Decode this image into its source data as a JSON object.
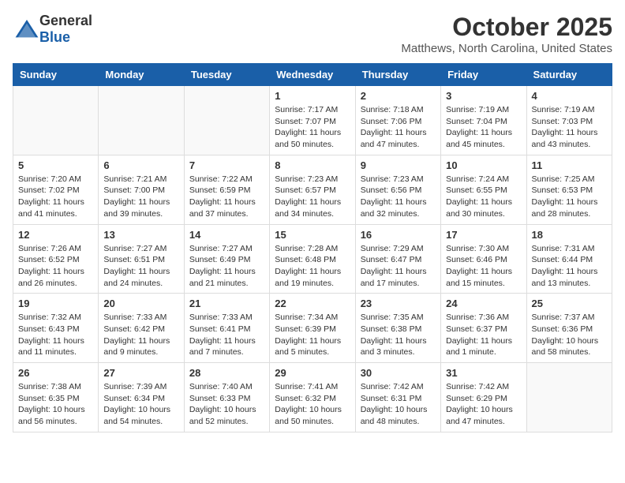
{
  "logo": {
    "general": "General",
    "blue": "Blue"
  },
  "title": "October 2025",
  "location": "Matthews, North Carolina, United States",
  "days_of_week": [
    "Sunday",
    "Monday",
    "Tuesday",
    "Wednesday",
    "Thursday",
    "Friday",
    "Saturday"
  ],
  "weeks": [
    [
      {
        "day": "",
        "info": ""
      },
      {
        "day": "",
        "info": ""
      },
      {
        "day": "",
        "info": ""
      },
      {
        "day": "1",
        "info": "Sunrise: 7:17 AM\nSunset: 7:07 PM\nDaylight: 11 hours\nand 50 minutes."
      },
      {
        "day": "2",
        "info": "Sunrise: 7:18 AM\nSunset: 7:06 PM\nDaylight: 11 hours\nand 47 minutes."
      },
      {
        "day": "3",
        "info": "Sunrise: 7:19 AM\nSunset: 7:04 PM\nDaylight: 11 hours\nand 45 minutes."
      },
      {
        "day": "4",
        "info": "Sunrise: 7:19 AM\nSunset: 7:03 PM\nDaylight: 11 hours\nand 43 minutes."
      }
    ],
    [
      {
        "day": "5",
        "info": "Sunrise: 7:20 AM\nSunset: 7:02 PM\nDaylight: 11 hours\nand 41 minutes."
      },
      {
        "day": "6",
        "info": "Sunrise: 7:21 AM\nSunset: 7:00 PM\nDaylight: 11 hours\nand 39 minutes."
      },
      {
        "day": "7",
        "info": "Sunrise: 7:22 AM\nSunset: 6:59 PM\nDaylight: 11 hours\nand 37 minutes."
      },
      {
        "day": "8",
        "info": "Sunrise: 7:23 AM\nSunset: 6:57 PM\nDaylight: 11 hours\nand 34 minutes."
      },
      {
        "day": "9",
        "info": "Sunrise: 7:23 AM\nSunset: 6:56 PM\nDaylight: 11 hours\nand 32 minutes."
      },
      {
        "day": "10",
        "info": "Sunrise: 7:24 AM\nSunset: 6:55 PM\nDaylight: 11 hours\nand 30 minutes."
      },
      {
        "day": "11",
        "info": "Sunrise: 7:25 AM\nSunset: 6:53 PM\nDaylight: 11 hours\nand 28 minutes."
      }
    ],
    [
      {
        "day": "12",
        "info": "Sunrise: 7:26 AM\nSunset: 6:52 PM\nDaylight: 11 hours\nand 26 minutes."
      },
      {
        "day": "13",
        "info": "Sunrise: 7:27 AM\nSunset: 6:51 PM\nDaylight: 11 hours\nand 24 minutes."
      },
      {
        "day": "14",
        "info": "Sunrise: 7:27 AM\nSunset: 6:49 PM\nDaylight: 11 hours\nand 21 minutes."
      },
      {
        "day": "15",
        "info": "Sunrise: 7:28 AM\nSunset: 6:48 PM\nDaylight: 11 hours\nand 19 minutes."
      },
      {
        "day": "16",
        "info": "Sunrise: 7:29 AM\nSunset: 6:47 PM\nDaylight: 11 hours\nand 17 minutes."
      },
      {
        "day": "17",
        "info": "Sunrise: 7:30 AM\nSunset: 6:46 PM\nDaylight: 11 hours\nand 15 minutes."
      },
      {
        "day": "18",
        "info": "Sunrise: 7:31 AM\nSunset: 6:44 PM\nDaylight: 11 hours\nand 13 minutes."
      }
    ],
    [
      {
        "day": "19",
        "info": "Sunrise: 7:32 AM\nSunset: 6:43 PM\nDaylight: 11 hours\nand 11 minutes."
      },
      {
        "day": "20",
        "info": "Sunrise: 7:33 AM\nSunset: 6:42 PM\nDaylight: 11 hours\nand 9 minutes."
      },
      {
        "day": "21",
        "info": "Sunrise: 7:33 AM\nSunset: 6:41 PM\nDaylight: 11 hours\nand 7 minutes."
      },
      {
        "day": "22",
        "info": "Sunrise: 7:34 AM\nSunset: 6:39 PM\nDaylight: 11 hours\nand 5 minutes."
      },
      {
        "day": "23",
        "info": "Sunrise: 7:35 AM\nSunset: 6:38 PM\nDaylight: 11 hours\nand 3 minutes."
      },
      {
        "day": "24",
        "info": "Sunrise: 7:36 AM\nSunset: 6:37 PM\nDaylight: 11 hours\nand 1 minute."
      },
      {
        "day": "25",
        "info": "Sunrise: 7:37 AM\nSunset: 6:36 PM\nDaylight: 10 hours\nand 58 minutes."
      }
    ],
    [
      {
        "day": "26",
        "info": "Sunrise: 7:38 AM\nSunset: 6:35 PM\nDaylight: 10 hours\nand 56 minutes."
      },
      {
        "day": "27",
        "info": "Sunrise: 7:39 AM\nSunset: 6:34 PM\nDaylight: 10 hours\nand 54 minutes."
      },
      {
        "day": "28",
        "info": "Sunrise: 7:40 AM\nSunset: 6:33 PM\nDaylight: 10 hours\nand 52 minutes."
      },
      {
        "day": "29",
        "info": "Sunrise: 7:41 AM\nSunset: 6:32 PM\nDaylight: 10 hours\nand 50 minutes."
      },
      {
        "day": "30",
        "info": "Sunrise: 7:42 AM\nSunset: 6:31 PM\nDaylight: 10 hours\nand 48 minutes."
      },
      {
        "day": "31",
        "info": "Sunrise: 7:42 AM\nSunset: 6:29 PM\nDaylight: 10 hours\nand 47 minutes."
      },
      {
        "day": "",
        "info": ""
      }
    ]
  ]
}
